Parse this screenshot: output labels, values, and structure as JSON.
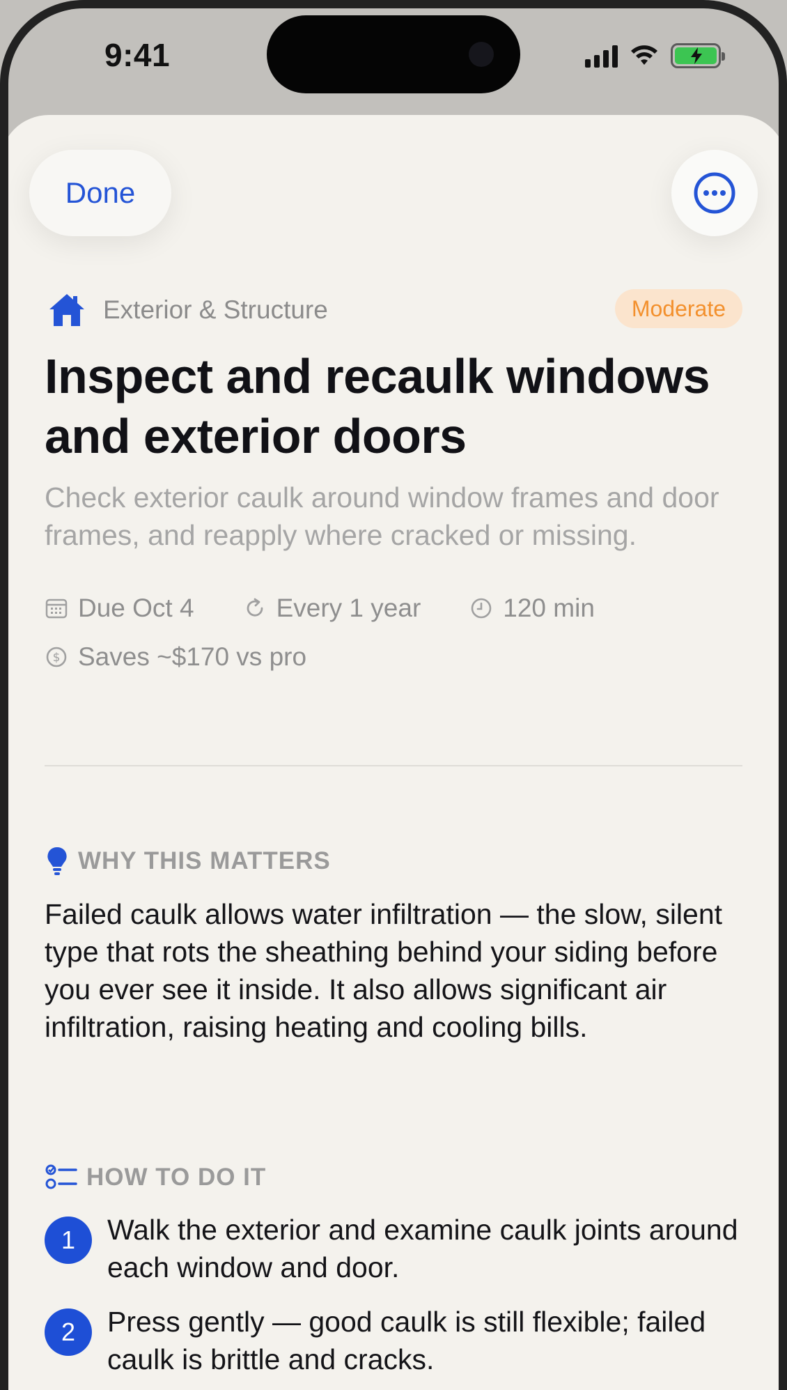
{
  "status_bar": {
    "time": "9:41"
  },
  "nav": {
    "done_label": "Done",
    "more_icon": "ellipsis-circle-icon"
  },
  "task": {
    "category_icon": "house-icon",
    "category": "Exterior & Structure",
    "difficulty": "Moderate",
    "title": "Inspect and recaulk windows and exterior doors",
    "description": "Check exterior caulk around window frames and door frames, and reapply where cracked or missing.",
    "meta": {
      "due": "Due Oct 4",
      "frequency": "Every 1 year",
      "duration": "120 min",
      "savings": "Saves ~$170 vs pro"
    }
  },
  "why": {
    "heading": "WHY THIS MATTERS",
    "body": "Failed caulk allows water infiltration — the slow, silent type that rots the sheathing behind your siding before you ever see it inside. It also allows significant air infiltration, raising heating and cooling bills."
  },
  "how": {
    "heading": "HOW TO DO IT",
    "steps": [
      {
        "number": "1",
        "text": "Walk the exterior and examine caulk joints around each window and door."
      },
      {
        "number": "2",
        "text": "Press gently — good caulk is still flexible; failed caulk is brittle and cracks."
      }
    ]
  },
  "colors": {
    "accent": "#1e4fd6",
    "badge_bg": "#fbe4cd",
    "badge_text": "#f3902d",
    "background": "#f4f2ed"
  }
}
